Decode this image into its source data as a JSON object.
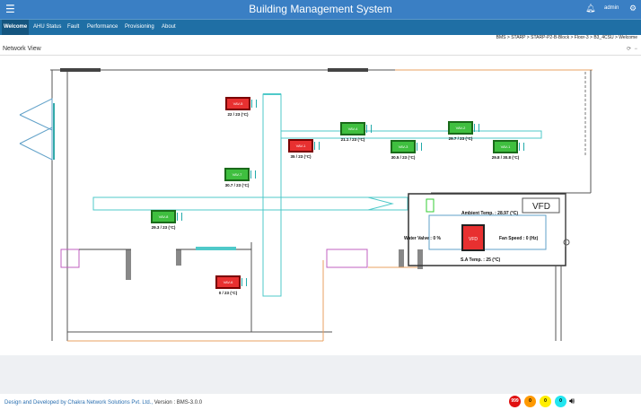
{
  "header": {
    "title": "Building Management System",
    "menu_icon": "hamburger-icon",
    "bell_icon": "bell-icon",
    "user": "admin",
    "settings_icon": "gear-icon"
  },
  "nav": {
    "tabs": [
      "Welcome",
      "AHU Status",
      "Fault",
      "Performance",
      "Provisioning",
      "About"
    ],
    "active": "Welcome"
  },
  "breadcrumb": "BMS  >  STARP  >  STARP-P2-B-Block  >  Floor-3  >  B3_4CSU  >  Welcome",
  "panel": {
    "title": "Network View",
    "icons": [
      "refresh-icon",
      "collapse-icon"
    ]
  },
  "vavs": [
    {
      "label": "VAV-5",
      "reading": "22 / 23 (°C)",
      "status": "alarm"
    },
    {
      "label": "VAV-4",
      "reading": "21.1 / 23 (°C)",
      "status": "normal"
    },
    {
      "label": "VAV-2",
      "reading": "29.7 / 23 (°C)",
      "status": "normal"
    },
    {
      "label": "VAV-1",
      "reading": "35 / 23 (°C)",
      "status": "alarm"
    },
    {
      "label": "VAV-3",
      "reading": "30.5 / 23 (°C)",
      "status": "normal"
    },
    {
      "label": "VAV-1",
      "reading": "29.8 / 30.8 (°C)",
      "status": "normal"
    },
    {
      "label": "VAV-7",
      "reading": "30.7 / 23 (°C)",
      "status": "normal"
    },
    {
      "label": "VAV-8",
      "reading": "29.3 / 23 (°C)",
      "status": "normal"
    },
    {
      "label": "VAV-6",
      "reading": "0 / 23 (°C)",
      "status": "alarm"
    }
  ],
  "ahu": {
    "vfd_label": "VFD",
    "ambient": "Ambient Temp. : 28.97 (°C)",
    "water_valve": "Water Valve : 0 %",
    "fan_speed": "Fan Speed : 0 (Hz)",
    "supply_temp": "S.A Temp. : 25 (°C)",
    "unit_label": "VFD"
  },
  "footer": {
    "credit": "Design and Developed by Chakra Network Solutions Pvt. Ltd.,",
    "version": " Version : BMS-3.0.0"
  },
  "alarm_counts": [
    {
      "value": "999",
      "color": "#e01010"
    },
    {
      "value": "0",
      "color": "#ff9900"
    },
    {
      "value": "0",
      "color": "#ffee00"
    },
    {
      "value": "0",
      "color": "#22e6f0"
    }
  ],
  "colors": {
    "header": "#3a7fc4",
    "nav": "#1f6fa5",
    "alarm": "#e83030",
    "normal": "#3fbf3f",
    "duct": "#4fd0d0"
  }
}
